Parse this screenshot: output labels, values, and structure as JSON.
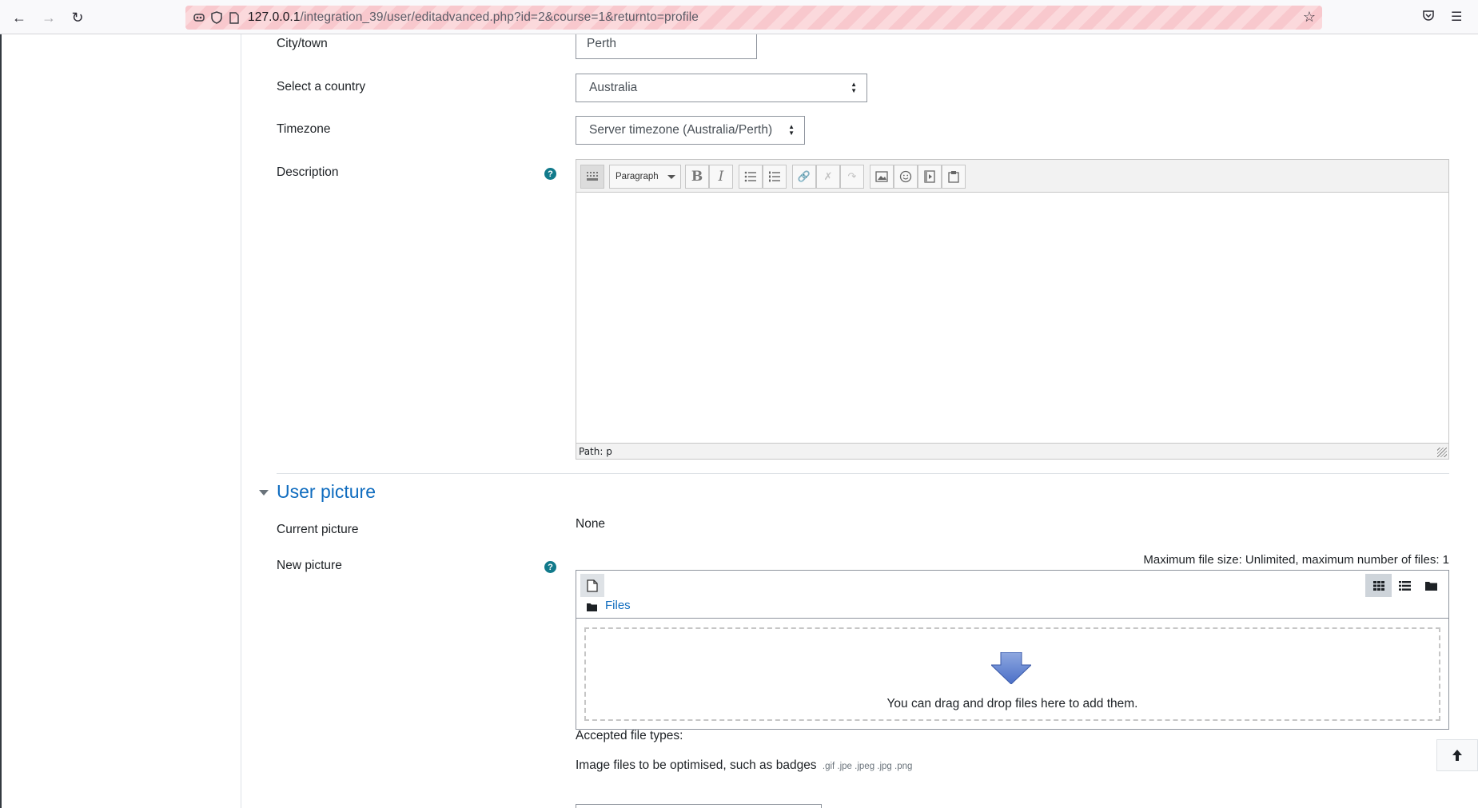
{
  "browser": {
    "url_host": "127.0.0.1",
    "url_path": "/integration_39/user/editadvanced.php?id=2&course=1&returnto=profile"
  },
  "form": {
    "city": {
      "label": "City/town",
      "value": "Perth"
    },
    "country": {
      "label": "Select a country",
      "value": "Australia"
    },
    "timezone": {
      "label": "Timezone",
      "value": "Server timezone (Australia/Perth)"
    },
    "description": {
      "label": "Description",
      "format_dropdown": "Paragraph",
      "path_text": "Path: p"
    }
  },
  "user_picture": {
    "section_title": "User picture",
    "current_label": "Current picture",
    "current_value": "None",
    "new_label": "New picture",
    "max_size_text": "Maximum file size: Unlimited, maximum number of files: 1",
    "path_label": "Files",
    "drop_text": "You can drag and drop files here to add them.",
    "accepted_label": "Accepted file types:",
    "accepted_desc": "Image files to be optimised, such as badges",
    "accepted_exts": ".gif .jpe .jpeg .jpg .png"
  },
  "colors": {
    "link": "#0f6cbf",
    "help": "#117a8b",
    "url_warning_bg": "#fbd9dc"
  }
}
